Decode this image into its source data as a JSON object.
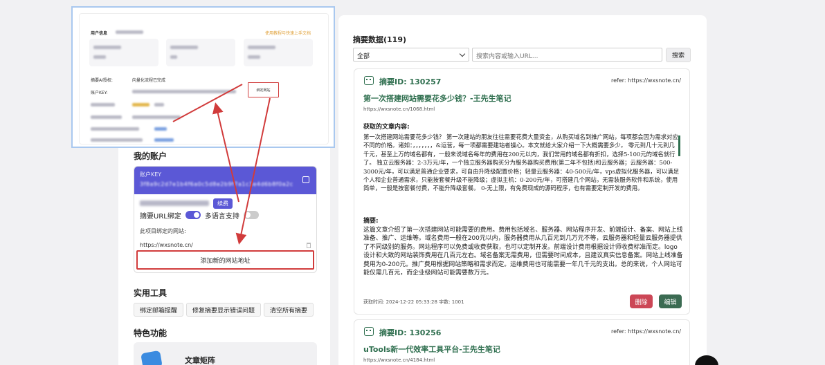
{
  "overlay": {
    "user_info_label": "用户信息",
    "tutorial_link": "使用教程与快速上手文档",
    "ai_auth_label": "摘要AI授权:",
    "ai_auth_value": "向量化流程已完成",
    "account_key_label": "账户KEY:",
    "bind_button": "绑定网站"
  },
  "account": {
    "section_title": "我的账户",
    "key_label": "账户KEY",
    "key_value": "3f8a9c2d7e1b4f6a0c5d8e2b9f7a1c3e4d6b8f0a2c",
    "renew_button": "续费",
    "toggle_url_bind_label": "摘要URL绑定",
    "toggle_url_bind_on": true,
    "toggle_multilang_label": "多语言支持",
    "toggle_multilang_on": false,
    "bound_sites_label": "此项目绑定的网站:",
    "bound_site": "https://wxsnote.cn/",
    "add_site_button": "添加新的网站地址"
  },
  "tools": {
    "section_title": "实用工具",
    "buttons": [
      "绑定邮箱提醒",
      "修复摘要显示错误问题",
      "清空所有摘要"
    ]
  },
  "features": {
    "section_title": "特色功能",
    "item_label": "文章矩阵"
  },
  "summaries": {
    "title": "摘要数据(119)",
    "filter_selected": "全部",
    "search_placeholder": "搜索内容或输入URL...",
    "search_button": "搜索",
    "cards": [
      {
        "id": "摘要ID: 130257",
        "refer": "refer: https://wxsnote.cn/",
        "title": "第一次搭建网站需要花多少钱？-王先生笔记",
        "url": "https://wxsnote.cn/1068.html",
        "article_heading": "获取的文章内容:",
        "article": "第一次搭建网站需要花多少钱？ 第一次建站的朋友往往需要花费大量资金，从购买域名到推广网站，每项都会因为需求对应不同的价格。诸如：，，，，，，，&运营，每一项都需要建站者操心。本文就给大家介绍一下大概需要多少。 零元到几十元到几千元，甚至上万的域名都有，一般来说域名每年的费用在200元以内，我们常用的域名都有折扣，选择5-100元的域名就行了。 独立云服务器：2-3万元/年，一个独立服务器购买分为服务器购买费用(第二年不包括)和云服务器；云服务器：500-3000元/年，可以满足普通企业要求，可自由升降级配置价格；轻量云服务器：40-500元/年，vps虚拟化服务器，可以满足个人和企业普通需求，只能按套餐升级不能降级；虚拟主机：0-200元/年，可搭建几个网站，无需装服务软件和系统，使用简单，一般是按套餐付费，不能升降级套餐。 0-无上限，有免费现成的源码程序，也有需要定制开发的费用。",
        "summary_heading": "摘要:",
        "summary": "这篇文章介绍了第一次搭建网站可能需要的费用。费用包括域名、服务器、网站程序开发、前端设计、备案、网站上线准备、推广、运维等。域名费用一般在200元以内，服务器费用从几百元到几万元不等，云服务器和轻量云服务器提供了不同级别的服务。网站程序可以免费或收费获取，也可以定制开发。前端设计费用根据设计师收费标准而定。logo设计和大致的网站装饰费用在几百元左右。域名备案无需费用，但需要时间成本，且建议真实信息备案。网站上线准备费用为0-200元。推广费用根据网站策略和需求而定。运维费用也可能需要一年几千元的支出。总的来说，个人网站可能仅需几百元，而企业级网站可能需要数万元。",
        "meta": "获取时间: 2024-12-22 05:33:28 字数: 1001",
        "delete_button": "删除",
        "edit_button": "编辑"
      },
      {
        "id": "摘要ID: 130256",
        "refer": "refer: https://wxsnote.cn/",
        "title": "uTools新一代效率工具平台-王先生笔记",
        "url": "https://wxsnote.cn/4184.html"
      }
    ]
  }
}
